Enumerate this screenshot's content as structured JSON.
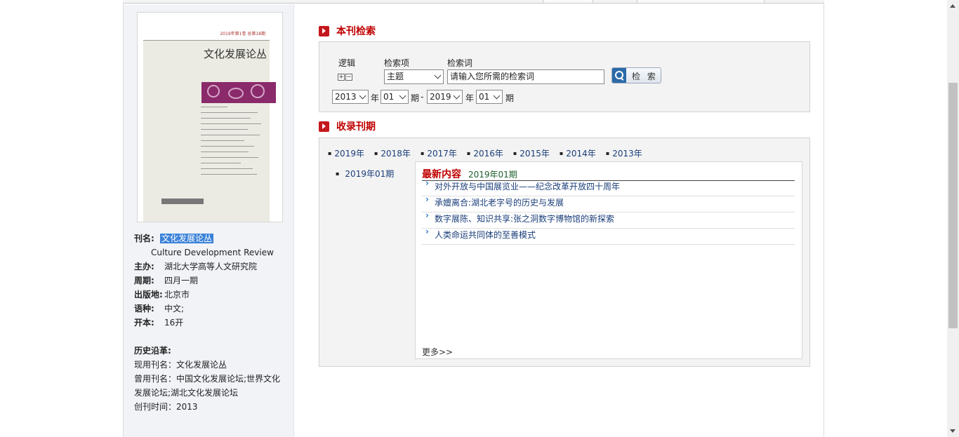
{
  "cover": {
    "issue_strip": "2019年第1卷 总第18期",
    "title": "文化发展论丛"
  },
  "journal_info": {
    "name_label": "刊名:",
    "name_value": "文化发展论丛",
    "english_name": "Culture Development Review",
    "sponsor_label": "主办:",
    "sponsor_value": "湖北大学高等人文研究院",
    "period_label": "周期:",
    "period_value": "四月一期",
    "place_label": "出版地:",
    "place_value": "北京市",
    "language_label": "语种:",
    "language_value": "中文;",
    "format_label": "开本:",
    "format_value": "16开",
    "history_title": "历史沿革:",
    "history_current": "现用刊名：文化发展论丛",
    "history_former_1": "曾用刊名：中国文化发展论坛;世界文化",
    "history_former_2": "发展论坛;湖北文化发展论坛",
    "history_founded": "创刊时间：2013"
  },
  "search": {
    "section_title": "本刊检索",
    "logic_label": "逻辑",
    "field_label": "检索项",
    "term_label": "检索词",
    "plus": "+",
    "minus": "−",
    "field_value": "主题",
    "term_value": "请输入您所需的检索词",
    "button_label": "检 索",
    "from_year": "2013",
    "year_unit": "年",
    "from_issue": "01",
    "issue_unit": "期",
    "dash": "-",
    "to_year": "2019",
    "to_issue": "01"
  },
  "issues": {
    "section_title": "收录刊期",
    "years": [
      "2019年",
      "2018年",
      "2017年",
      "2016年",
      "2015年",
      "2014年",
      "2013年"
    ],
    "selected_issue": "2019年01期"
  },
  "latest": {
    "title": "最新内容",
    "issue": "2019年01期",
    "articles": [
      "对外开放与中国展览业——纪念改革开放四十周年",
      "承嬗离合:湖北老字号的历史与发展",
      "数字展陈、知识共享:张之洞数字博物馆的新探索",
      "人类命运共同体的至善模式"
    ],
    "more": "更多>>"
  }
}
